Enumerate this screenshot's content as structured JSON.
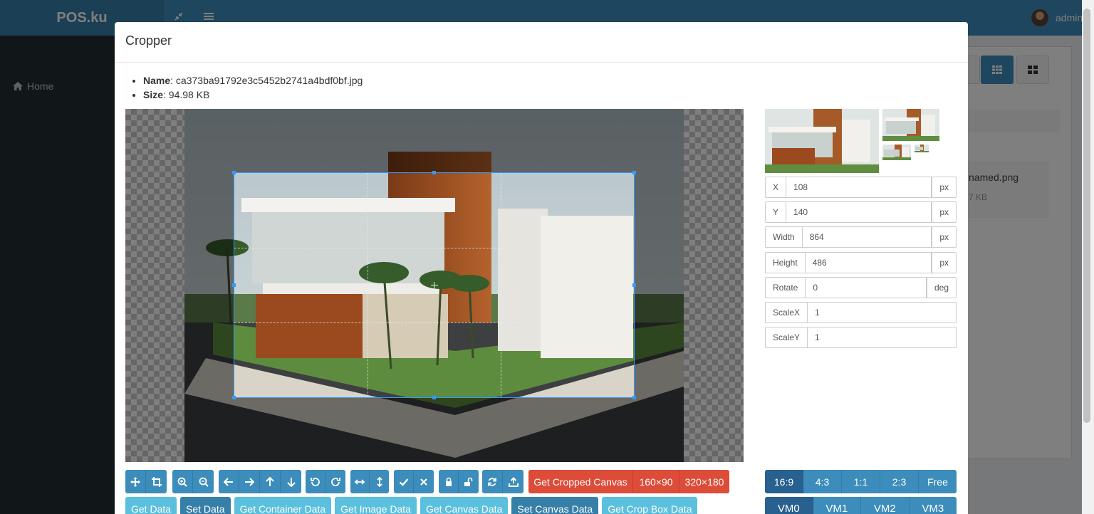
{
  "app": {
    "logo": "POS.ku",
    "user_name": "admin",
    "sidebar_home": "Home"
  },
  "background": {
    "file_name": "named.png",
    "file_size": "7 KB"
  },
  "modal": {
    "title": "Cropper",
    "name_label": "Name",
    "name_value": ": ca373ba91792e3c5452b2741a4bdf0bf.jpg",
    "size_label": "Size",
    "size_value": ": 94.98 KB"
  },
  "data_fields": [
    {
      "label": "X",
      "value": "108",
      "unit": "px"
    },
    {
      "label": "Y",
      "value": "140",
      "unit": "px"
    },
    {
      "label": "Width",
      "value": "864",
      "unit": "px"
    },
    {
      "label": "Height",
      "value": "486",
      "unit": "px"
    },
    {
      "label": "Rotate",
      "value": "0",
      "unit": "deg"
    },
    {
      "label": "ScaleX",
      "value": "1"
    },
    {
      "label": "ScaleY",
      "value": "1"
    }
  ],
  "toolbar": {
    "icons": [
      "move-icon",
      "crop-icon",
      "zoom-in-icon",
      "zoom-out-icon",
      "arrow-left-icon",
      "arrow-right-icon",
      "arrow-up-icon",
      "arrow-down-icon",
      "rotate-left-icon",
      "rotate-right-icon",
      "flip-horizontal-icon",
      "flip-vertical-icon",
      "check-icon",
      "close-icon",
      "lock-icon",
      "unlock-icon",
      "reset-icon",
      "upload-icon"
    ],
    "get_cropped_canvas": "Get Cropped Canvas",
    "size_160": "160×90",
    "size_320": "320×180",
    "get_data": "Get Data",
    "set_data": "Set Data",
    "get_container_data": "Get Container Data",
    "get_image_data": "Get Image Data",
    "get_canvas_data": "Get Canvas Data",
    "set_canvas_data": "Set Canvas Data",
    "get_crop_box_data": "Get Crop Box Data"
  },
  "aspect_ratios": [
    "16:9",
    "4:3",
    "1:1",
    "2:3",
    "Free"
  ],
  "aspect_active": "16:9",
  "view_modes": [
    "VM0",
    "VM1",
    "VM2",
    "VM3"
  ],
  "view_mode_active": "VM0",
  "colors": {
    "primary": "#3c8dbc",
    "primary_dark": "#286090",
    "danger": "#dd4b39",
    "info": "#5bc0de",
    "crop_outline": "#3399ff"
  }
}
